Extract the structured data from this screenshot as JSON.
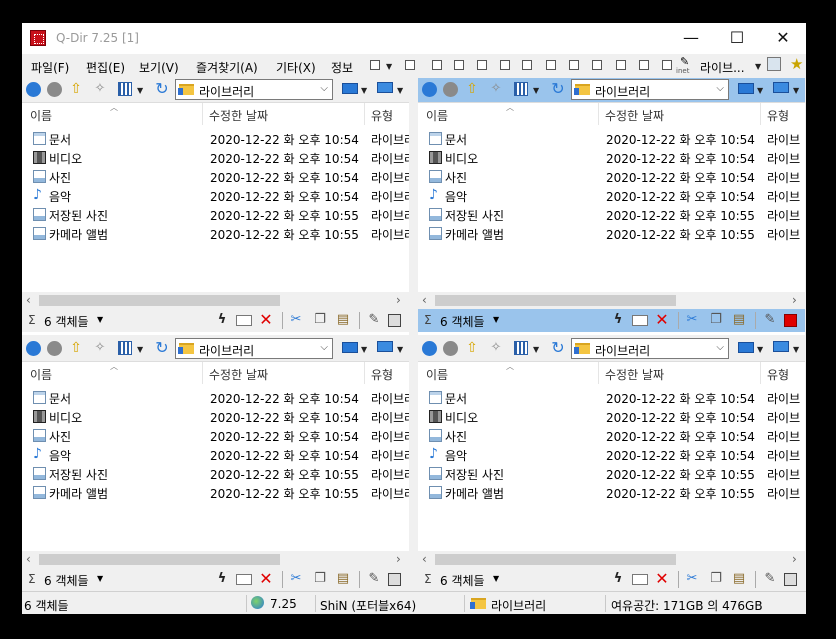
{
  "window": {
    "title": "Q-Dir 7.25 [1]"
  },
  "caption_buttons": {
    "minimize": "—",
    "maximize": "☐",
    "close": "✕"
  },
  "menu": {
    "items": [
      "파일(F)",
      "편집(E)",
      "보기(V)",
      "즐겨찾기(A)",
      "기타(X)",
      "정보"
    ],
    "library_label": "라이브...",
    "inet_label": "inet"
  },
  "panes": [
    {
      "path": "라이브러리",
      "active": false,
      "columns": {
        "name": "이름",
        "modified": "수정한 날짜",
        "type": "유형"
      },
      "rows": [
        {
          "name": "문서",
          "modified": "2020-12-22 화 오후 10:54",
          "type": "라이브러",
          "icon": "document-library-icon"
        },
        {
          "name": "비디오",
          "modified": "2020-12-22 화 오후 10:54",
          "type": "라이브러",
          "icon": "video-library-icon"
        },
        {
          "name": "사진",
          "modified": "2020-12-22 화 오후 10:54",
          "type": "라이브러",
          "icon": "picture-library-icon"
        },
        {
          "name": "음악",
          "modified": "2020-12-22 화 오후 10:54",
          "type": "라이브러",
          "icon": "music-library-icon"
        },
        {
          "name": "저장된 사진",
          "modified": "2020-12-22 화 오후 10:55",
          "type": "라이브러",
          "icon": "picture-library-icon"
        },
        {
          "name": "카메라 앨범",
          "modified": "2020-12-22 화 오후 10:55",
          "type": "라이브러",
          "icon": "picture-library-icon"
        }
      ],
      "status": {
        "sigma": "Σ",
        "count": "6 객체들"
      }
    },
    {
      "path": "라이브러리",
      "active": true,
      "columns": {
        "name": "이름",
        "modified": "수정한 날짜",
        "type": "유형"
      },
      "rows": [
        {
          "name": "문서",
          "modified": "2020-12-22 화 오후 10:54",
          "type": "라이브",
          "icon": "document-library-icon"
        },
        {
          "name": "비디오",
          "modified": "2020-12-22 화 오후 10:54",
          "type": "라이브",
          "icon": "video-library-icon"
        },
        {
          "name": "사진",
          "modified": "2020-12-22 화 오후 10:54",
          "type": "라이브",
          "icon": "picture-library-icon"
        },
        {
          "name": "음악",
          "modified": "2020-12-22 화 오후 10:54",
          "type": "라이브",
          "icon": "music-library-icon"
        },
        {
          "name": "저장된 사진",
          "modified": "2020-12-22 화 오후 10:55",
          "type": "라이브",
          "icon": "picture-library-icon"
        },
        {
          "name": "카메라 앨범",
          "modified": "2020-12-22 화 오후 10:55",
          "type": "라이브",
          "icon": "picture-library-icon"
        }
      ],
      "status": {
        "sigma": "Σ",
        "count": "6 객체들"
      }
    },
    {
      "path": "라이브러리",
      "active": false,
      "columns": {
        "name": "이름",
        "modified": "수정한 날짜",
        "type": "유형"
      },
      "rows": [
        {
          "name": "문서",
          "modified": "2020-12-22 화 오후 10:54",
          "type": "라이브러",
          "icon": "document-library-icon"
        },
        {
          "name": "비디오",
          "modified": "2020-12-22 화 오후 10:54",
          "type": "라이브러",
          "icon": "video-library-icon"
        },
        {
          "name": "사진",
          "modified": "2020-12-22 화 오후 10:54",
          "type": "라이브러",
          "icon": "picture-library-icon"
        },
        {
          "name": "음악",
          "modified": "2020-12-22 화 오후 10:54",
          "type": "라이브러",
          "icon": "music-library-icon"
        },
        {
          "name": "저장된 사진",
          "modified": "2020-12-22 화 오후 10:55",
          "type": "라이브러",
          "icon": "picture-library-icon"
        },
        {
          "name": "카메라 앨범",
          "modified": "2020-12-22 화 오후 10:55",
          "type": "라이브러",
          "icon": "picture-library-icon"
        }
      ],
      "status": {
        "sigma": "Σ",
        "count": "6 객체들"
      }
    },
    {
      "path": "라이브러리",
      "active": false,
      "columns": {
        "name": "이름",
        "modified": "수정한 날짜",
        "type": "유형"
      },
      "rows": [
        {
          "name": "문서",
          "modified": "2020-12-22 화 오후 10:54",
          "type": "라이브",
          "icon": "document-library-icon"
        },
        {
          "name": "비디오",
          "modified": "2020-12-22 화 오후 10:54",
          "type": "라이브",
          "icon": "video-library-icon"
        },
        {
          "name": "사진",
          "modified": "2020-12-22 화 오후 10:54",
          "type": "라이브",
          "icon": "picture-library-icon"
        },
        {
          "name": "음악",
          "modified": "2020-12-22 화 오후 10:54",
          "type": "라이브",
          "icon": "music-library-icon"
        },
        {
          "name": "저장된 사진",
          "modified": "2020-12-22 화 오후 10:55",
          "type": "라이브",
          "icon": "picture-library-icon"
        },
        {
          "name": "카메라 앨범",
          "modified": "2020-12-22 화 오후 10:55",
          "type": "라이브",
          "icon": "picture-library-icon"
        }
      ],
      "status": {
        "sigma": "Σ",
        "count": "6 객체들"
      }
    }
  ],
  "statusbar": {
    "count": "6 객체들",
    "version": "7.25",
    "author": "ShiN (포터블x64)",
    "location": "라이브러리",
    "free_space": "여유공간: 171GB 의 476GB"
  },
  "colors": {
    "active_pane": "#9ac4ec",
    "accent_blue": "#2a79d6",
    "delete_red": "#e00000"
  }
}
